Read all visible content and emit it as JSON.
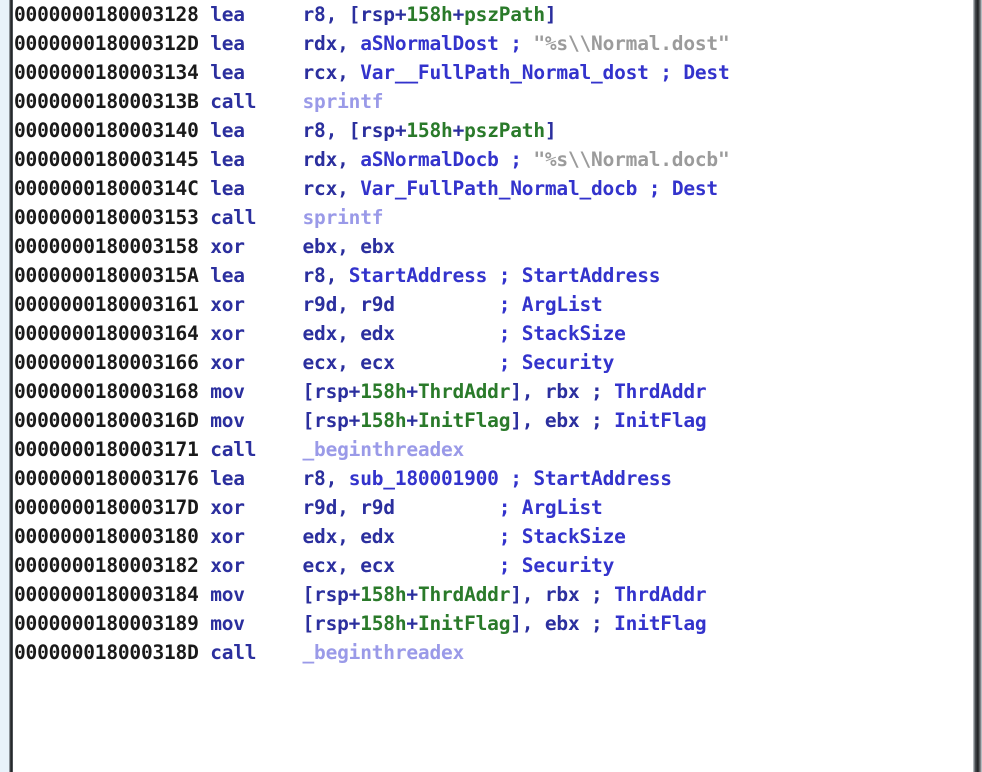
{
  "window": {
    "kind": "disassembly-listing",
    "title": "IDA View Disassembly",
    "font_style": "monospace",
    "colors": {
      "background": "#ffffff",
      "address": "#1a1a1a",
      "mnemonic": "#2b2f9e",
      "operand": "#2b2f9e",
      "number": "#2a7a2a",
      "stack_variable": "#2a7a2a",
      "data_reference": "#3333cc",
      "call_reference": "#9a9ae8",
      "comment": "#3333cc",
      "string_literal": "#9b9b9b",
      "left_gutter": "#e8f2fa",
      "frame": "#202325"
    }
  },
  "listing": {
    "lines": [
      {
        "address": "0000000180003128",
        "mnemonic": "lea",
        "parts": [
          {
            "t": "r8, [rsp+",
            "c": "ops"
          },
          {
            "t": "158h",
            "c": "num"
          },
          {
            "t": "+",
            "c": "ops"
          },
          {
            "t": "pszPath",
            "c": "stkvar"
          },
          {
            "t": "]",
            "c": "ops"
          }
        ]
      },
      {
        "address": "000000018000312D",
        "mnemonic": "lea",
        "parts": [
          {
            "t": "rdx, ",
            "c": "ops"
          },
          {
            "t": "aSNormalDost",
            "c": "dataref"
          },
          {
            "t": " ; ",
            "c": "cmt"
          },
          {
            "t": "\"%s\\\\Normal.dost\"",
            "c": "strlit"
          }
        ]
      },
      {
        "address": "0000000180003134",
        "mnemonic": "lea",
        "parts": [
          {
            "t": "rcx, ",
            "c": "ops"
          },
          {
            "t": "Var__FullPath_Normal_dost",
            "c": "dataref"
          },
          {
            "t": " ; ",
            "c": "cmt"
          },
          {
            "t": "Dest",
            "c": "cmt"
          }
        ]
      },
      {
        "address": "000000018000313B",
        "mnemonic": "call",
        "parts": [
          {
            "t": "sprintf",
            "c": "callref"
          }
        ]
      },
      {
        "address": "0000000180003140",
        "mnemonic": "lea",
        "parts": [
          {
            "t": "r8, [rsp+",
            "c": "ops"
          },
          {
            "t": "158h",
            "c": "num"
          },
          {
            "t": "+",
            "c": "ops"
          },
          {
            "t": "pszPath",
            "c": "stkvar"
          },
          {
            "t": "]",
            "c": "ops"
          }
        ]
      },
      {
        "address": "0000000180003145",
        "mnemonic": "lea",
        "parts": [
          {
            "t": "rdx, ",
            "c": "ops"
          },
          {
            "t": "aSNormalDocb",
            "c": "dataref"
          },
          {
            "t": " ; ",
            "c": "cmt"
          },
          {
            "t": "\"%s\\\\Normal.docb\"",
            "c": "strlit"
          }
        ]
      },
      {
        "address": "000000018000314C",
        "mnemonic": "lea",
        "parts": [
          {
            "t": "rcx, ",
            "c": "ops"
          },
          {
            "t": "Var_FullPath_Normal_docb",
            "c": "dataref"
          },
          {
            "t": " ; ",
            "c": "cmt"
          },
          {
            "t": "Dest",
            "c": "cmt"
          }
        ]
      },
      {
        "address": "0000000180003153",
        "mnemonic": "call",
        "parts": [
          {
            "t": "sprintf",
            "c": "callref"
          }
        ]
      },
      {
        "address": "0000000180003158",
        "mnemonic": "xor",
        "parts": [
          {
            "t": "ebx, ebx",
            "c": "ops"
          }
        ]
      },
      {
        "address": "000000018000315A",
        "mnemonic": "lea",
        "parts": [
          {
            "t": "r8, ",
            "c": "ops"
          },
          {
            "t": "StartAddress",
            "c": "dataref"
          },
          {
            "t": " ; ",
            "c": "cmt"
          },
          {
            "t": "StartAddress",
            "c": "cmt"
          }
        ]
      },
      {
        "address": "0000000180003161",
        "mnemonic": "xor",
        "parts": [
          {
            "t": "r9d, r9d",
            "c": "ops"
          },
          {
            "t": "         ; ",
            "c": "cmt"
          },
          {
            "t": "ArgList",
            "c": "cmt"
          }
        ]
      },
      {
        "address": "0000000180003164",
        "mnemonic": "xor",
        "parts": [
          {
            "t": "edx, edx",
            "c": "ops"
          },
          {
            "t": "         ; ",
            "c": "cmt"
          },
          {
            "t": "StackSize",
            "c": "cmt"
          }
        ]
      },
      {
        "address": "0000000180003166",
        "mnemonic": "xor",
        "parts": [
          {
            "t": "ecx, ecx",
            "c": "ops"
          },
          {
            "t": "         ; ",
            "c": "cmt"
          },
          {
            "t": "Security",
            "c": "cmt"
          }
        ]
      },
      {
        "address": "0000000180003168",
        "mnemonic": "mov",
        "parts": [
          {
            "t": "[rsp+",
            "c": "ops"
          },
          {
            "t": "158h",
            "c": "num"
          },
          {
            "t": "+",
            "c": "ops"
          },
          {
            "t": "ThrdAddr",
            "c": "stkvar"
          },
          {
            "t": "], rbx ; ",
            "c": "ops"
          },
          {
            "t": "ThrdAddr",
            "c": "cmt"
          }
        ]
      },
      {
        "address": "000000018000316D",
        "mnemonic": "mov",
        "parts": [
          {
            "t": "[rsp+",
            "c": "ops"
          },
          {
            "t": "158h",
            "c": "num"
          },
          {
            "t": "+",
            "c": "ops"
          },
          {
            "t": "InitFlag",
            "c": "stkvar"
          },
          {
            "t": "], ebx ; ",
            "c": "ops"
          },
          {
            "t": "InitFlag",
            "c": "cmt"
          }
        ]
      },
      {
        "address": "0000000180003171",
        "mnemonic": "call",
        "parts": [
          {
            "t": "_beginthreadex",
            "c": "callref"
          }
        ]
      },
      {
        "address": "0000000180003176",
        "mnemonic": "lea",
        "parts": [
          {
            "t": "r8, ",
            "c": "ops"
          },
          {
            "t": "sub_180001900",
            "c": "dataref"
          },
          {
            "t": " ; ",
            "c": "cmt"
          },
          {
            "t": "StartAddress",
            "c": "cmt"
          }
        ]
      },
      {
        "address": "000000018000317D",
        "mnemonic": "xor",
        "parts": [
          {
            "t": "r9d, r9d",
            "c": "ops"
          },
          {
            "t": "         ; ",
            "c": "cmt"
          },
          {
            "t": "ArgList",
            "c": "cmt"
          }
        ]
      },
      {
        "address": "0000000180003180",
        "mnemonic": "xor",
        "parts": [
          {
            "t": "edx, edx",
            "c": "ops"
          },
          {
            "t": "         ; ",
            "c": "cmt"
          },
          {
            "t": "StackSize",
            "c": "cmt"
          }
        ]
      },
      {
        "address": "0000000180003182",
        "mnemonic": "xor",
        "parts": [
          {
            "t": "ecx, ecx",
            "c": "ops"
          },
          {
            "t": "         ; ",
            "c": "cmt"
          },
          {
            "t": "Security",
            "c": "cmt"
          }
        ]
      },
      {
        "address": "0000000180003184",
        "mnemonic": "mov",
        "parts": [
          {
            "t": "[rsp+",
            "c": "ops"
          },
          {
            "t": "158h",
            "c": "num"
          },
          {
            "t": "+",
            "c": "ops"
          },
          {
            "t": "ThrdAddr",
            "c": "stkvar"
          },
          {
            "t": "], rbx ; ",
            "c": "ops"
          },
          {
            "t": "ThrdAddr",
            "c": "cmt"
          }
        ]
      },
      {
        "address": "0000000180003189",
        "mnemonic": "mov",
        "parts": [
          {
            "t": "[rsp+",
            "c": "ops"
          },
          {
            "t": "158h",
            "c": "num"
          },
          {
            "t": "+",
            "c": "ops"
          },
          {
            "t": "InitFlag",
            "c": "stkvar"
          },
          {
            "t": "], ebx ; ",
            "c": "ops"
          },
          {
            "t": "InitFlag",
            "c": "cmt"
          }
        ]
      },
      {
        "address": "000000018000318D",
        "mnemonic": "call",
        "parts": [
          {
            "t": "_beginthreadex",
            "c": "callref"
          }
        ]
      },
      {
        "address": "",
        "mnemonic": "",
        "clipped": true,
        "parts": [
          {
            "t": "",
            "c": "ops"
          }
        ]
      }
    ]
  }
}
